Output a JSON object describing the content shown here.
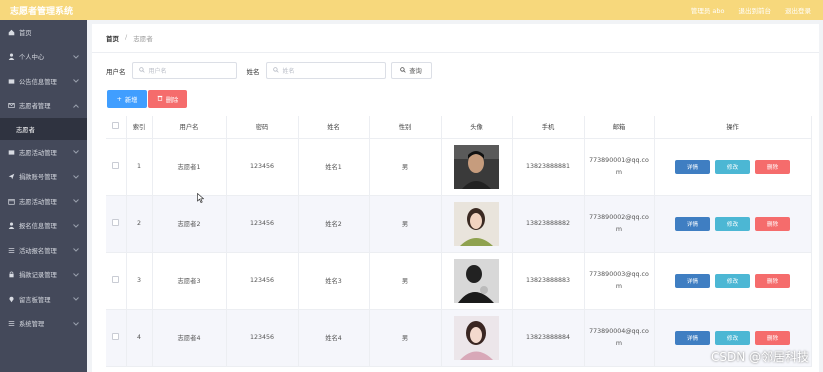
{
  "app": {
    "title": "志愿者管理系统"
  },
  "header": {
    "admin": "管理员 abo",
    "back_front": "退出到前台",
    "logout": "退出登录"
  },
  "sidebar": {
    "items": [
      {
        "label": "首页",
        "icon": "home-icon",
        "submenu": false
      },
      {
        "label": "个人中心",
        "icon": "user-icon",
        "submenu": true
      },
      {
        "label": "公告信息管理",
        "icon": "message-icon",
        "submenu": true
      },
      {
        "label": "志愿者管理",
        "icon": "mail-icon",
        "submenu": true,
        "open": true,
        "children": [
          {
            "label": "志愿者"
          }
        ]
      },
      {
        "label": "志愿活动管理",
        "icon": "message-icon",
        "submenu": true
      },
      {
        "label": "捐款账号管理",
        "icon": "send-icon",
        "submenu": true
      },
      {
        "label": "志愿活动管理",
        "icon": "calendar-icon",
        "submenu": true
      },
      {
        "label": "报名信息管理",
        "icon": "user-icon",
        "submenu": true
      },
      {
        "label": "活动报名管理",
        "icon": "list-icon",
        "submenu": true
      },
      {
        "label": "捐款记录管理",
        "icon": "lock-icon",
        "submenu": true
      },
      {
        "label": "留言板管理",
        "icon": "location-icon",
        "submenu": true
      },
      {
        "label": "系统管理",
        "icon": "list-icon",
        "submenu": true
      }
    ]
  },
  "breadcrumb": {
    "home": "首页",
    "separator": "/",
    "current": "志愿者"
  },
  "search": {
    "username_label": "用户名",
    "username_placeholder": "用户名",
    "name_label": "姓名",
    "name_placeholder": "姓名",
    "query_button": "查询"
  },
  "actions": {
    "add": "新增",
    "delete": "删除"
  },
  "table": {
    "headers": [
      "索引",
      "用户名",
      "密码",
      "姓名",
      "性别",
      "头像",
      "手机",
      "邮箱",
      "操作"
    ],
    "rows": [
      {
        "index": "1",
        "username": "志愿者1",
        "password": "123456",
        "name": "姓名1",
        "gender": "男",
        "phone": "13823888881",
        "email": "773890001@qq.com",
        "avatar": "portrait-dark"
      },
      {
        "index": "2",
        "username": "志愿者2",
        "password": "123456",
        "name": "姓名2",
        "gender": "男",
        "phone": "13823888882",
        "email": "773890002@qq.com",
        "avatar": "portrait-light"
      },
      {
        "index": "3",
        "username": "志愿者3",
        "password": "123456",
        "name": "姓名3",
        "gender": "男",
        "phone": "13823888883",
        "email": "773890003@qq.com",
        "avatar": "portrait-bw"
      },
      {
        "index": "4",
        "username": "志愿者4",
        "password": "123456",
        "name": "姓名4",
        "gender": "男",
        "phone": "13823888884",
        "email": "773890004@qq.com",
        "avatar": "portrait-pink"
      }
    ],
    "row_actions": {
      "detail": "详情",
      "edit": "修改",
      "delete": "删除"
    }
  },
  "watermark": "CSDN @邻居科技",
  "colors": {
    "topbar": "#f7d87c",
    "sidebar": "#44495a",
    "primary": "#409eff",
    "danger": "#f56c6c",
    "info": "#4cb7d4"
  }
}
